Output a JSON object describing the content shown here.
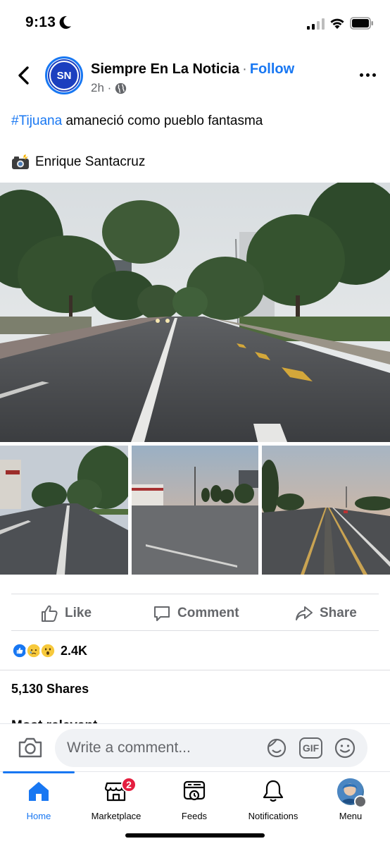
{
  "status_bar": {
    "time": "9:13"
  },
  "post": {
    "page_name": "Siempre En La Noticia",
    "separator": "·",
    "follow_label": "Follow",
    "time_ago": "2h ·",
    "avatar_initials": "SN",
    "hashtag": "#Tijuana",
    "text": " amaneció como pueblo fantasma",
    "credit": "Enrique Santacruz"
  },
  "actions": {
    "like": "Like",
    "comment": "Comment",
    "share": "Share"
  },
  "stats": {
    "reaction_count": "2.4K",
    "shares": "5,130 Shares"
  },
  "peek_text": "Most relevant",
  "comment_bar": {
    "placeholder": "Write a comment...",
    "gif_label": "GIF"
  },
  "tabs": [
    {
      "label": "Home",
      "icon": "home-icon",
      "active": true
    },
    {
      "label": "Marketplace",
      "icon": "marketplace-icon",
      "badge": "2"
    },
    {
      "label": "Feeds",
      "icon": "feeds-icon"
    },
    {
      "label": "Notifications",
      "icon": "bell-icon"
    },
    {
      "label": "Menu",
      "icon": "profile-avatar"
    }
  ],
  "colors": {
    "accent": "#1877f2",
    "secondary_text": "#65676b",
    "badge": "#e41e3f"
  }
}
